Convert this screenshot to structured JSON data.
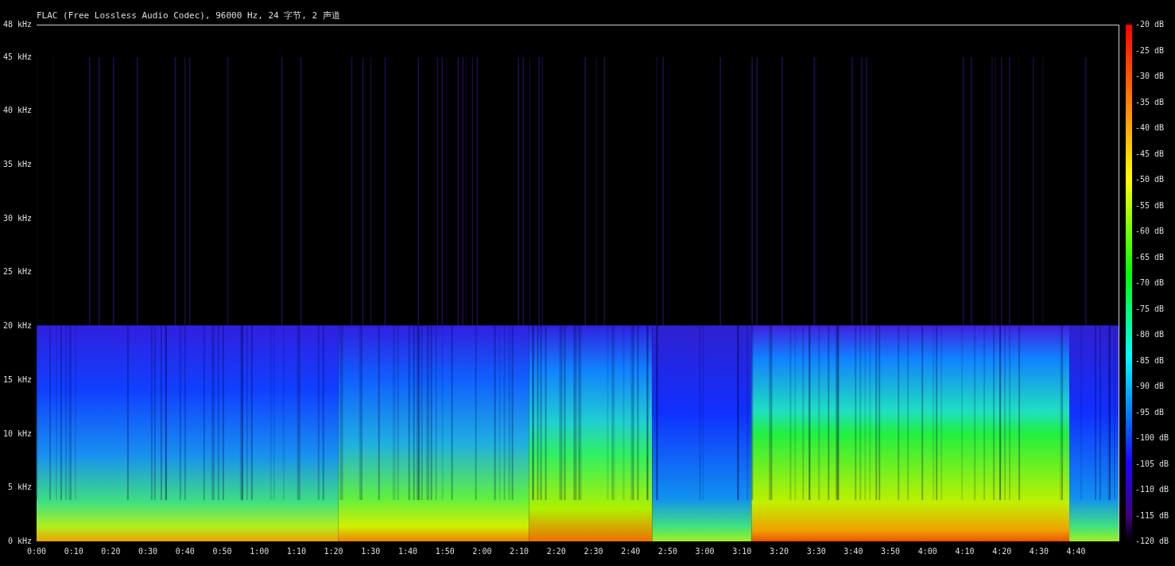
{
  "file_info": "FLAC (Free Lossless Audio Codec), 96000 Hz, 24 字节, 2 声道",
  "frequency_axis": {
    "ticks": [
      "48 kHz",
      "45 kHz",
      "40 kHz",
      "35 kHz",
      "30 kHz",
      "25 kHz",
      "20 kHz",
      "15 kHz",
      "10 kHz",
      "5 kHz",
      "0 kHz"
    ]
  },
  "time_axis": {
    "ticks": [
      "0:00",
      "0:10",
      "0:20",
      "0:30",
      "0:40",
      "0:50",
      "1:00",
      "1:10",
      "1:20",
      "1:30",
      "1:40",
      "1:50",
      "2:00",
      "2:10",
      "2:20",
      "2:30",
      "2:40",
      "2:50",
      "3:00",
      "3:10",
      "3:20",
      "3:30",
      "3:40",
      "3:50",
      "4:00",
      "4:10",
      "4:20",
      "4:30",
      "4:40"
    ]
  },
  "color_scale": {
    "ticks": [
      "-20 dB",
      "-25 dB",
      "-30 dB",
      "-35 dB",
      "-40 dB",
      "-45 dB",
      "-50 dB",
      "-55 dB",
      "-60 dB",
      "-65 dB",
      "-70 dB",
      "-75 dB",
      "-80 dB",
      "-85 dB",
      "-90 dB",
      "-95 dB",
      "-100 dB",
      "-105 dB",
      "-110 dB",
      "-115 dB",
      "-120 dB"
    ]
  }
}
